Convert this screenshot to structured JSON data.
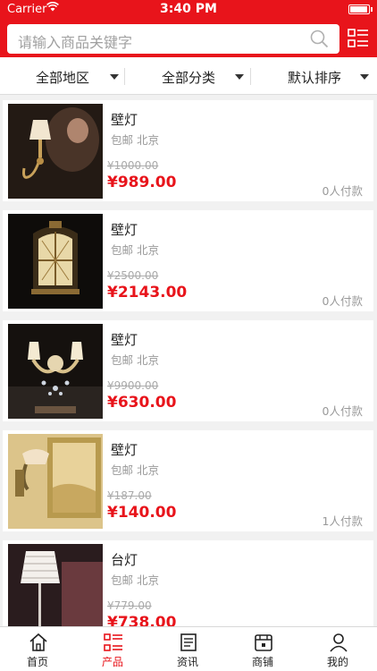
{
  "status_bar": {
    "carrier": "Carrier",
    "time": "3:40 PM"
  },
  "search": {
    "placeholder": "请输入商品关键字"
  },
  "filters": [
    {
      "label": "全部地区"
    },
    {
      "label": "全部分类"
    },
    {
      "label": "默认排序"
    }
  ],
  "products": [
    {
      "name": "壁灯",
      "shipping": "包邮 北京",
      "original_price": "¥1000.00",
      "price": "¥989.00",
      "paid": "0人付款"
    },
    {
      "name": "壁灯",
      "shipping": "包邮 北京",
      "original_price": "¥2500.00",
      "price": "¥2143.00",
      "paid": "0人付款"
    },
    {
      "name": "壁灯",
      "shipping": "包邮 北京",
      "original_price": "¥9900.00",
      "price": "¥630.00",
      "paid": "0人付款"
    },
    {
      "name": "壁灯",
      "shipping": "包邮 北京",
      "original_price": "¥187.00",
      "price": "¥140.00",
      "paid": "1人付款"
    },
    {
      "name": "台灯",
      "shipping": "包邮 北京",
      "original_price": "¥779.00",
      "price": "¥738.00",
      "paid": ""
    }
  ],
  "tabbar": {
    "tabs": [
      {
        "label": "首页",
        "icon": "home-icon"
      },
      {
        "label": "产品",
        "icon": "list-icon"
      },
      {
        "label": "资讯",
        "icon": "news-icon"
      },
      {
        "label": "商铺",
        "icon": "store-icon"
      },
      {
        "label": "我的",
        "icon": "user-icon"
      }
    ],
    "active": "产品"
  },
  "colors": {
    "brand": "#e8141b",
    "background": "#f1f1f1"
  }
}
